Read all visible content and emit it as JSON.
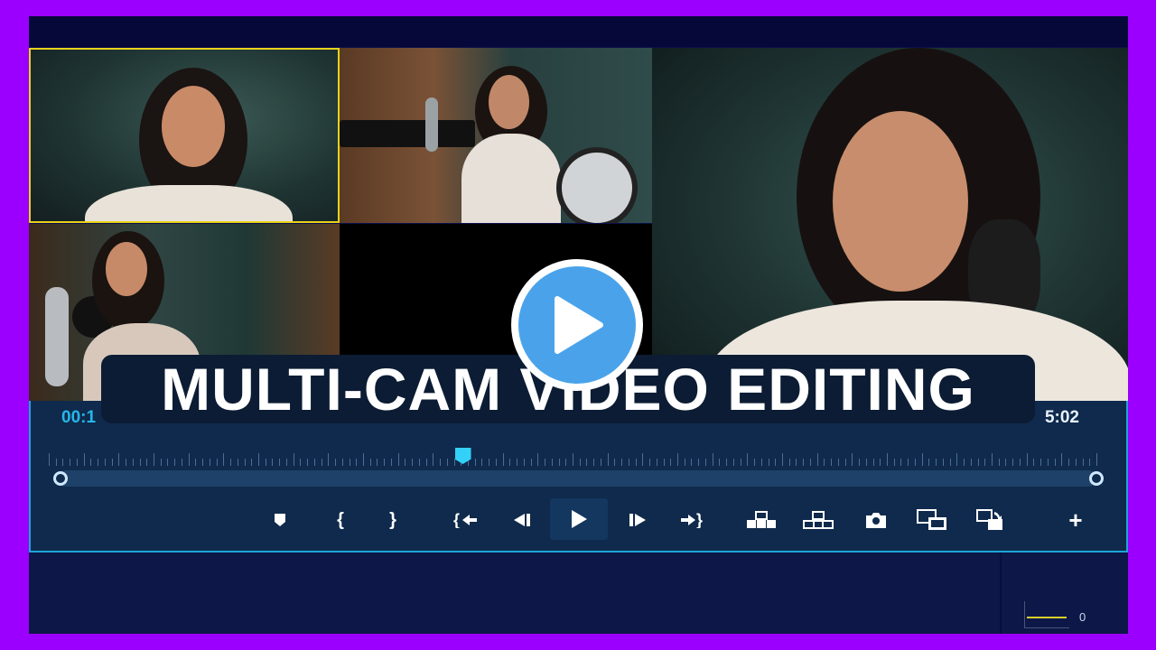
{
  "overlay": {
    "title": "MULTI-CAM VIDEO EDITING",
    "play_icon": "play-circle-icon"
  },
  "viewer": {
    "cameras": [
      "camera-1-closeup",
      "camera-2-wide",
      "camera-3-vocal-booth",
      "camera-4-empty"
    ],
    "active_camera_border": "#e8d21a",
    "program": "program-monitor"
  },
  "timeline": {
    "current_time": "00:1",
    "total_time": "5:02",
    "playhead_position": 0.39,
    "accent": "#33d1f7"
  },
  "controls": [
    {
      "name": "marker-icon"
    },
    {
      "name": "mark-in-icon",
      "glyph": "{"
    },
    {
      "name": "mark-out-icon",
      "glyph": "}"
    },
    {
      "name": "go-to-in-icon"
    },
    {
      "name": "step-back-icon"
    },
    {
      "name": "play-icon"
    },
    {
      "name": "step-forward-icon"
    },
    {
      "name": "go-to-out-icon"
    },
    {
      "name": "insert-icon"
    },
    {
      "name": "overwrite-icon"
    },
    {
      "name": "snapshot-icon"
    },
    {
      "name": "match-frame-icon"
    },
    {
      "name": "replace-icon"
    },
    {
      "name": "add-icon",
      "glyph": "+"
    }
  ],
  "audio_meter": {
    "value": "0",
    "level_color": "#d7cf2a"
  }
}
